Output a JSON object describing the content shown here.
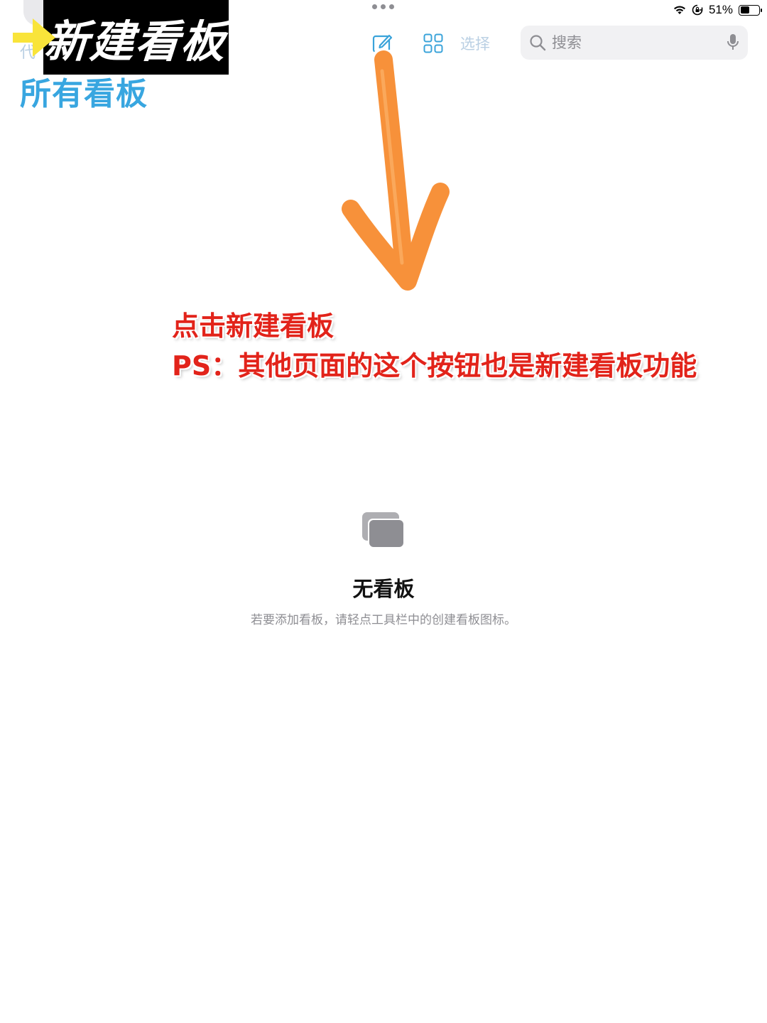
{
  "status_bar": {
    "battery_percent": "51%",
    "battery_level": 0.51,
    "icons": [
      "wifi-icon",
      "orientation-lock-icon",
      "battery-icon"
    ]
  },
  "toolbar": {
    "compose_icon": "new-board-icon",
    "grid_icon": "grid-view-icon",
    "select_label": "选择"
  },
  "search": {
    "placeholder": "搜索",
    "icon": "search-icon",
    "mic_icon": "microphone-icon"
  },
  "header": {
    "back_glyph": "代",
    "page_title": "所有看板"
  },
  "overlay": {
    "banner_text": "新建看板",
    "annotation_line1": "点击新建看板",
    "annotation_line2": "PS：其他页面的这个按钮也是新建看板功能"
  },
  "empty_state": {
    "icon": "stacked-boards-icon",
    "title": "无看板",
    "subtitle": "若要添加看板，请轻点工具栏中的创建看板图标。"
  },
  "colors": {
    "accent": "#38a6e0",
    "toolbar_icon": "#3aa3da",
    "disabled": "#b9cfe3",
    "annotation_red": "#e2231a",
    "drawn_arrow_orange": "#f7913a",
    "banner_arrow_yellow": "#f9e43a",
    "empty_icon_gray": "#8e8e93"
  }
}
